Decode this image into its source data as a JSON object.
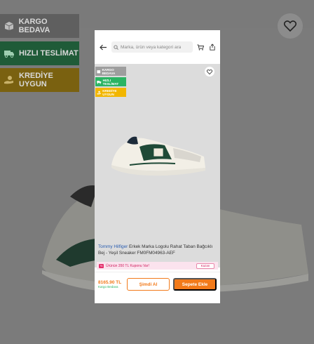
{
  "background": {
    "badges": [
      {
        "label": "KARGO BEDAVA",
        "icon": "box-icon"
      },
      {
        "label": "HIZLI TESLİMAT",
        "icon": "truck-icon"
      },
      {
        "label": "KREDİYE UYGUN",
        "icon": "hand-coin-icon"
      }
    ],
    "favorite_icon": "heart-icon"
  },
  "modal": {
    "search": {
      "placeholder": "Marka, ürün veya kategori ara",
      "back_icon": "arrow-left-icon",
      "search_icon": "search-icon",
      "cart_icon": "cart-icon",
      "share_icon": "share-icon"
    },
    "badges": [
      {
        "label": "KARGO BEDAVA"
      },
      {
        "label": "HIZLI TESLİMAT"
      },
      {
        "label": "KREDİYE UYGUN"
      }
    ],
    "carousel": {
      "count": 5,
      "active": 0
    },
    "product": {
      "brand": "Tommy Hilfiger",
      "name": "Erkek Marka Logolu Rahat Taban Bağcıklı Bej - Yeşil Sneaker FM0FM04963-AEF",
      "stock_badge": "Son 2 Ürün"
    },
    "coupon": {
      "percent_icon": "%",
      "text": "Ürünün 350 TL Kuponu Var!",
      "button": "Kazan"
    },
    "bottom": {
      "price": "8165.90 TL",
      "cargo": "Kargo Bedava",
      "buy_now": "Şimdi Al",
      "add_to_cart": "Sepete Ekle"
    }
  },
  "colors": {
    "accent": "#f27a1a",
    "green": "#2bb463",
    "yellow": "#f2b600",
    "pink": "#d01f5f"
  }
}
